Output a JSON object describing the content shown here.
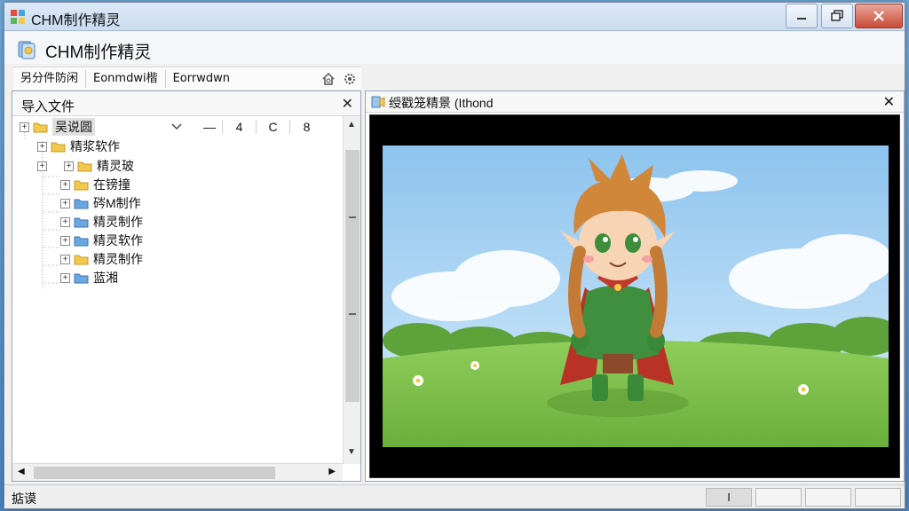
{
  "window": {
    "title": "CHM制作精灵"
  },
  "header": {
    "title": "CHM制作精灵"
  },
  "menu": {
    "items": [
      "另分件防闲",
      "Eonmdwi楷",
      "Eorrwdwn"
    ]
  },
  "left_panel": {
    "title": "导入文件",
    "root_tools": [
      "—",
      "4",
      "C",
      "8"
    ],
    "tree": [
      {
        "label": "吴说圆",
        "depth": 0,
        "folder": "yellow"
      },
      {
        "label": "精浆软作",
        "depth": 1,
        "folder": "yellow"
      },
      {
        "label": "精灵玻",
        "depth": 2,
        "folder": "yellow"
      },
      {
        "label": "在镑撞",
        "depth": 2,
        "folder": "yellow"
      },
      {
        "label": "硶M制作",
        "depth": 2,
        "folder": "blue"
      },
      {
        "label": "精灵制作",
        "depth": 2,
        "folder": "blue"
      },
      {
        "label": "精灵软作",
        "depth": 2,
        "folder": "blue"
      },
      {
        "label": "精灵制作",
        "depth": 2,
        "folder": "yellow"
      },
      {
        "label": "蓝湘",
        "depth": 2,
        "folder": "blue"
      }
    ]
  },
  "right_panel": {
    "title": "绶戳笼精景 (Ithond"
  },
  "status": {
    "text": "掂谟",
    "segment": "I"
  },
  "colors": {
    "title_close": "#c94a36",
    "folder_yellow": "#f2c94c",
    "folder_blue": "#6aa6e0",
    "grass": "#7cc04e",
    "sky": "#a8d3f2"
  }
}
